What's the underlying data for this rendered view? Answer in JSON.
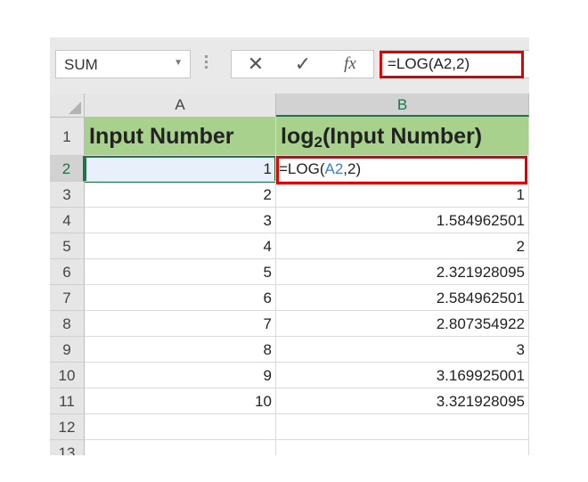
{
  "formula_bar": {
    "name_box_value": "SUM",
    "cancel_symbol": "✕",
    "enter_symbol": "✓",
    "fx_label": "fx",
    "formula_text": "=LOG(A2,2)"
  },
  "columns": [
    {
      "label": "A"
    },
    {
      "label": "B"
    }
  ],
  "header_row": {
    "row_label": "1",
    "a": "Input Number",
    "b_prefix": "log",
    "b_subscript": "2",
    "b_suffix": "(Input Number)"
  },
  "rows": [
    {
      "row": "2",
      "a": "1",
      "b": ""
    },
    {
      "row": "3",
      "a": "2",
      "b": "1"
    },
    {
      "row": "4",
      "a": "3",
      "b": "1.584962501"
    },
    {
      "row": "5",
      "a": "4",
      "b": "2"
    },
    {
      "row": "6",
      "a": "5",
      "b": "2.321928095"
    },
    {
      "row": "7",
      "a": "6",
      "b": "2.584962501"
    },
    {
      "row": "8",
      "a": "7",
      "b": "2.807354922"
    },
    {
      "row": "9",
      "a": "8",
      "b": "3"
    },
    {
      "row": "10",
      "a": "9",
      "b": "3.169925001"
    },
    {
      "row": "11",
      "a": "10",
      "b": "3.321928095"
    },
    {
      "row": "12",
      "a": "",
      "b": ""
    },
    {
      "row": "13",
      "a": "",
      "b": ""
    }
  ],
  "editing_cell": {
    "prefix": "=LOG(",
    "reference": "A2",
    "suffix": ",2)"
  },
  "colors": {
    "header_fill": "#a9d18e",
    "highlight_box": "#e00000",
    "selection_green": "#217346",
    "reference_blue": "#3a7fd0"
  }
}
